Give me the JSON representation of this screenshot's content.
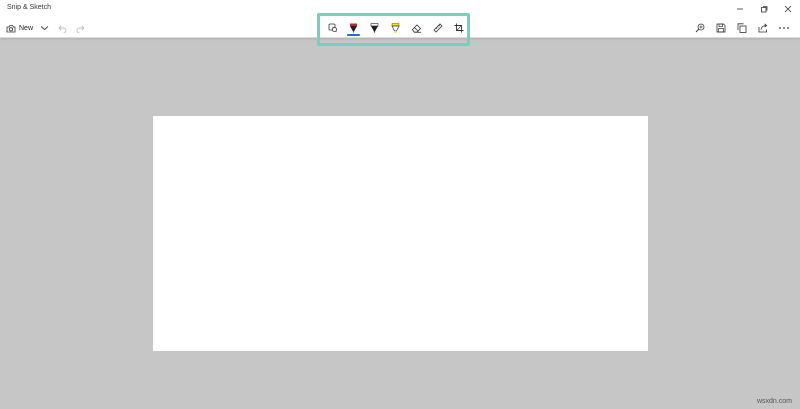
{
  "window": {
    "title": "Snip & Sketch"
  },
  "toolbar": {
    "new_label": "New"
  },
  "tools": {
    "items": [
      {
        "name": "touch-writing-icon"
      },
      {
        "name": "ballpoint-pen-icon",
        "selected": true,
        "color": "#c4262e"
      },
      {
        "name": "pencil-icon",
        "color": "#1f1f1f"
      },
      {
        "name": "highlighter-icon",
        "color": "#ffe600"
      },
      {
        "name": "eraser-icon"
      },
      {
        "name": "ruler-icon"
      },
      {
        "name": "crop-icon"
      }
    ]
  },
  "actions": [
    "zoom-icon",
    "save-icon",
    "copy-icon",
    "share-icon",
    "more-icon"
  ],
  "colors": {
    "highlight_border": "#6ad6bf",
    "selected_underline": "#1a6fcf",
    "background": "#c6c6c6"
  },
  "watermark": "wsxdn.com"
}
